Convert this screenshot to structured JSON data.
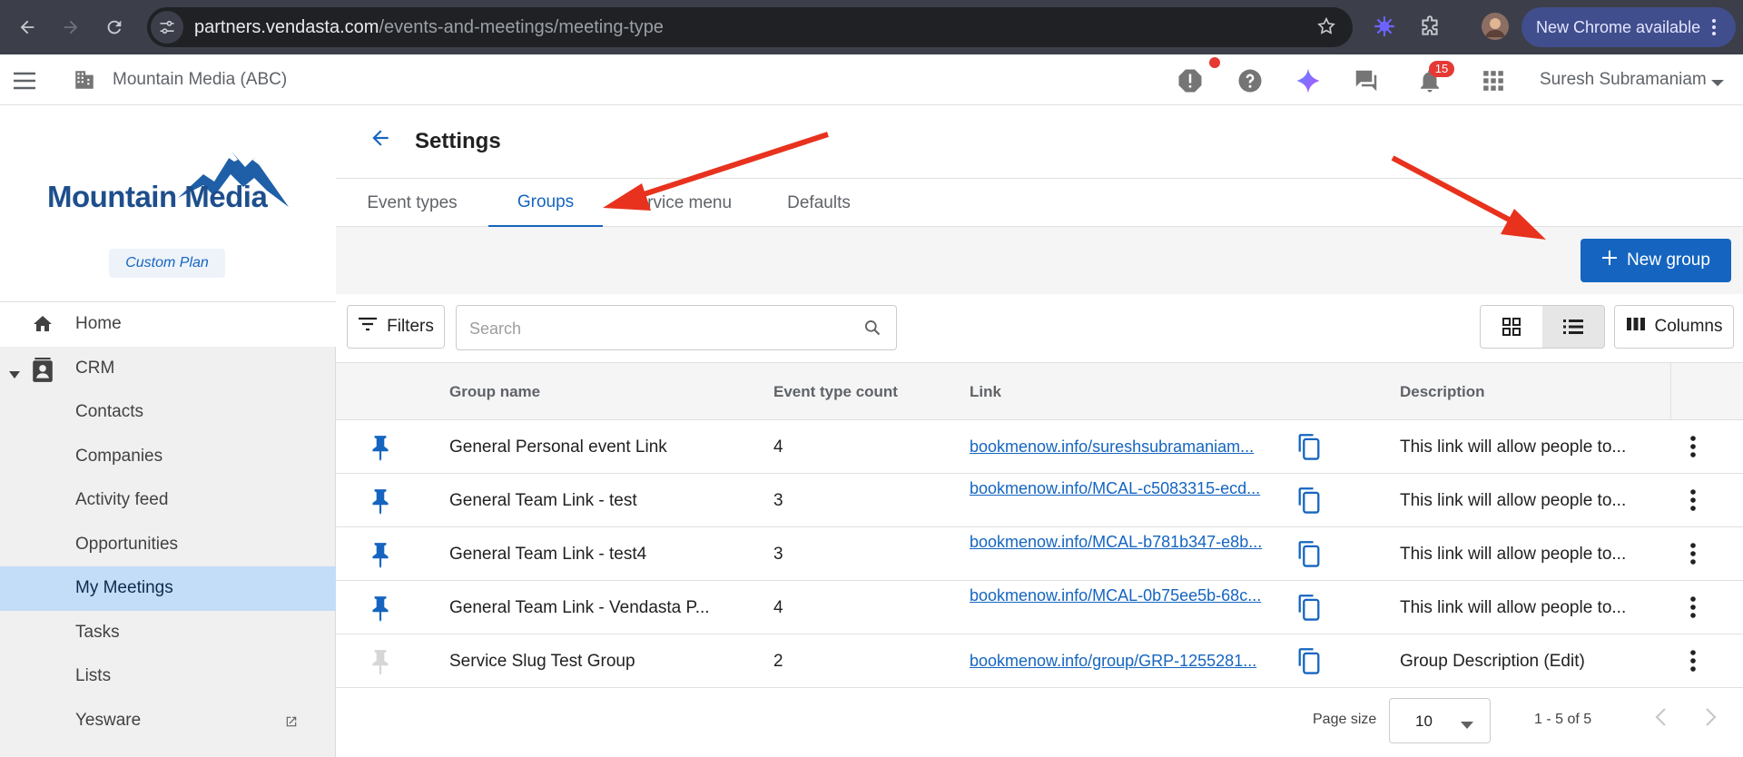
{
  "browser": {
    "url_host": "partners.vendasta.com",
    "url_path": "/events-and-meetings/meeting-type",
    "new_chrome_label": "New Chrome available"
  },
  "header": {
    "business_name": "Mountain Media (ABC)",
    "user_name": "Suresh Subramaniam",
    "notification_count": "15",
    "icons": [
      "alert-icon",
      "help-icon",
      "ai-sparkle-icon",
      "chat-icon",
      "bell-icon",
      "apps-grid-icon"
    ]
  },
  "sidebar": {
    "logo_text": "Mountain Media",
    "plan": "Custom Plan",
    "items": [
      {
        "label": "Home",
        "icon": "home-icon"
      },
      {
        "label": "CRM",
        "icon": "contacts-icon"
      },
      {
        "label": "Contacts"
      },
      {
        "label": "Companies"
      },
      {
        "label": "Activity feed"
      },
      {
        "label": "Opportunities"
      },
      {
        "label": "My Meetings"
      },
      {
        "label": "Tasks"
      },
      {
        "label": "Lists"
      },
      {
        "label": "Yesware"
      }
    ]
  },
  "main": {
    "title": "Settings",
    "tabs": [
      {
        "label": "Event types"
      },
      {
        "label": "Groups"
      },
      {
        "label": "Service menu"
      },
      {
        "label": "Defaults"
      }
    ],
    "new_group_label": "New group",
    "filters_label": "Filters",
    "search_placeholder": "Search",
    "columns_label": "Columns"
  },
  "table": {
    "headers": {
      "name": "Group name",
      "count": "Event type count",
      "link": "Link",
      "description": "Description"
    },
    "rows": [
      {
        "pinned": true,
        "name": "General Personal event Link",
        "count": "4",
        "link": "bookmenow.info/sureshsubramaniam...",
        "description": "This link will allow people to..."
      },
      {
        "pinned": true,
        "name": "General Team Link - test",
        "count": "3",
        "link": "bookmenow.info/MCAL-c5083315-ecd...",
        "description": "This link will allow people to..."
      },
      {
        "pinned": true,
        "name": "General Team Link - test4",
        "count": "3",
        "link": "bookmenow.info/MCAL-b781b347-e8b...",
        "description": "This link will allow people to..."
      },
      {
        "pinned": true,
        "name": "General Team Link - Vendasta P...",
        "count": "4",
        "link": "bookmenow.info/MCAL-0b75ee5b-68c...",
        "description": "This link will allow people to..."
      },
      {
        "pinned": false,
        "name": "Service Slug Test Group",
        "count": "2",
        "link": "bookmenow.info/group/GRP-1255281...",
        "description": "Group Description (Edit)"
      }
    ]
  },
  "pager": {
    "page_size_label": "Page size",
    "page_size_value": "10",
    "range": "1 - 5 of 5"
  },
  "colors": {
    "primary": "#1565c0",
    "active_nav": "#c3dcf8",
    "annotation_arrow": "#e8321e",
    "pin_active": "#1565c0",
    "pin_inactive": "#d6d6d6"
  }
}
